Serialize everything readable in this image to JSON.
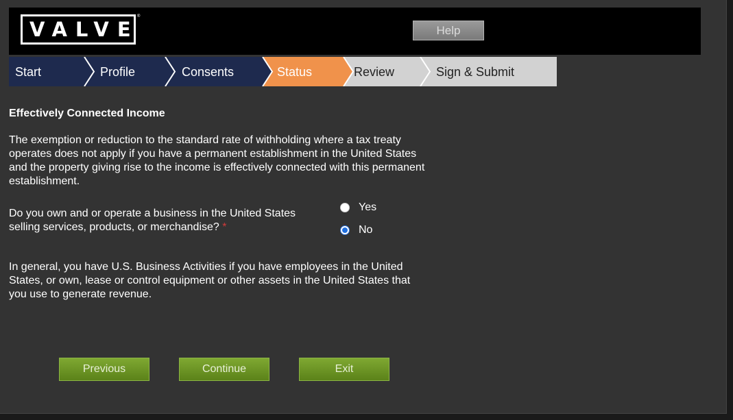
{
  "header": {
    "logo_text": "VALVE",
    "logo_tm": "®",
    "help_label": "Help"
  },
  "steps": [
    {
      "label": "Start",
      "state": "done"
    },
    {
      "label": "Profile",
      "state": "done"
    },
    {
      "label": "Consents",
      "state": "done"
    },
    {
      "label": "Status",
      "state": "active"
    },
    {
      "label": "Review",
      "state": "pending"
    },
    {
      "label": "Sign & Submit",
      "state": "pending"
    }
  ],
  "colors": {
    "step_done": "#1e2a4e",
    "step_active": "#f0924b",
    "step_pending": "#d2d2d2",
    "button_green": "#6b9326"
  },
  "section": {
    "title": "Effectively Connected Income",
    "paragraph1": "The exemption or reduction to the standard rate of withholding where a tax treaty operates does not apply if you have a permanent establishment in the United States and the property giving rise to the income is effectively connected with this permanent establishment.",
    "question": "Do you own and or operate a business in the United States selling services, products, or merchandise?",
    "required_mark": "*",
    "options": [
      {
        "label": "Yes",
        "selected": false
      },
      {
        "label": "No",
        "selected": true
      }
    ],
    "paragraph2": "In general, you have U.S. Business Activities if you have employees in the United States, or own, lease or control equipment or other assets in the United States that you use to generate revenue."
  },
  "buttons": {
    "previous": "Previous",
    "continue": "Continue",
    "exit": "Exit"
  }
}
